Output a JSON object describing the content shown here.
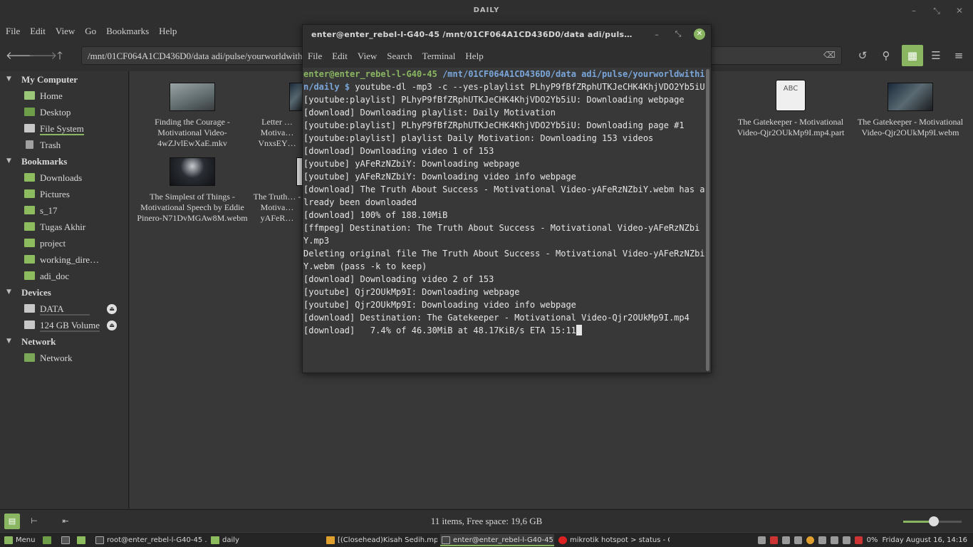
{
  "fm": {
    "title": "DAILY",
    "menu": [
      "File",
      "Edit",
      "View",
      "Go",
      "Bookmarks",
      "Help"
    ],
    "path": "/mnt/01CF064A1CD436D0/data adi/pulse/yourworldwithin/daily",
    "sidebar": {
      "my_computer": "My Computer",
      "computer_items": [
        "Home",
        "Desktop",
        "File System",
        "Trash"
      ],
      "bookmarks": "Bookmarks",
      "bookmark_items": [
        "Downloads",
        "Pictures",
        "s_17",
        "Tugas Akhir",
        "project",
        "working_dire…",
        "adi_doc"
      ],
      "devices": "Devices",
      "device_items": [
        "DATA",
        "124 GB Volume"
      ],
      "network": "Network",
      "network_items": [
        "Network"
      ]
    },
    "files": [
      {
        "name": "Finding the Courage - Motivational Video-4wZJvlEwXaE.mkv"
      },
      {
        "name": "Letter … Motiva… VnxsEY…"
      },
      {
        "name": "The Gatekeeper - Motivational Video-Qjr2OUkMp9I.mp4.part",
        "icon": "ABC"
      },
      {
        "name": "The Gatekeeper - Motivational Video-Qjr2OUkMp9I.webm"
      },
      {
        "name": "The Simplest of Things - Motivational Speech by Eddie Pinero-N71DvMGAw8M.webm"
      },
      {
        "name": "The Truth… - Motiva… yAFeR…"
      }
    ],
    "status": "11 items, Free space: 19,6 GB",
    "zoom_level": 0.52
  },
  "term": {
    "title": "enter@enter_rebel-l-G40-45 /mnt/01CF064A1CD436D0/data adi/puls…",
    "menu": [
      "File",
      "Edit",
      "View",
      "Search",
      "Terminal",
      "Help"
    ],
    "prompt_user": "enter@enter_rebel-l-G40-45",
    "prompt_path": "/mnt/01CF064A1CD436D0/data adi/pulse/yourworldwithin/daily",
    "prompt_sym": "$",
    "command": "youtube-dl -mp3 -c --yes-playlist PLhyP9fBfZRphUTKJeCHK4KhjVDO2Yb5iU",
    "lines": [
      "[youtube:playlist] PLhyP9fBfZRphUTKJeCHK4KhjVDO2Yb5iU: Downloading webpage",
      "[download] Downloading playlist: Daily Motivation",
      "[youtube:playlist] PLhyP9fBfZRphUTKJeCHK4KhjVDO2Yb5iU: Downloading page #1",
      "[youtube:playlist] playlist Daily Motivation: Downloading 153 videos",
      "[download] Downloading video 1 of 153",
      "[youtube] yAFeRzNZbiY: Downloading webpage",
      "[youtube] yAFeRzNZbiY: Downloading video info webpage",
      "[download] The Truth About Success - Motivational Video-yAFeRzNZbiY.webm has already been downloaded",
      "[download] 100% of 188.10MiB",
      "[ffmpeg] Destination: The Truth About Success - Motivational Video-yAFeRzNZbiY.mp3",
      "Deleting original file The Truth About Success - Motivational Video-yAFeRzNZbiY.webm (pass -k to keep)",
      "[download] Downloading video 2 of 153",
      "[youtube] Qjr2OUkMp9I: Downloading webpage",
      "[youtube] Qjr2OUkMp9I: Downloading video info webpage",
      "[download] Destination: The Gatekeeper - Motivational Video-Qjr2OUkMp9I.mp4",
      "[download]   7.4% of 46.30MiB at 48.17KiB/s ETA 15:11"
    ]
  },
  "taskbar": {
    "menu_label": "Menu",
    "windows": [
      "root@enter_rebel-l-G40-45 ...",
      "daily",
      "[(Closehead)Kisah Sedih.mp3]",
      "enter@enter_rebel-l-G40-45 ...",
      "mikrotik hotspot > status - O..."
    ],
    "battery": "0%",
    "clock": "Friday August 16, 14:16"
  },
  "colors": {
    "accent": "#8ab661",
    "prompt_path": "#7aa6da",
    "window_bg": "#383838"
  }
}
